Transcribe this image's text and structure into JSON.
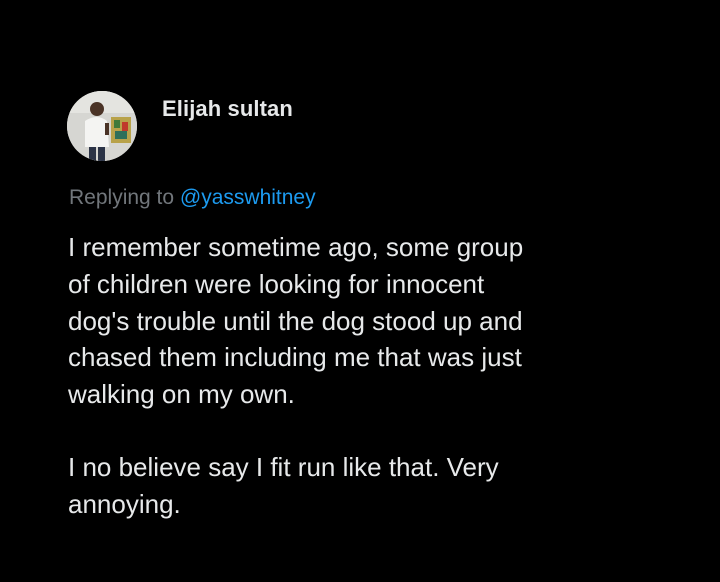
{
  "tweet": {
    "author": {
      "name": "Elijah sultan",
      "avatar_icon": "profile-photo"
    },
    "reply": {
      "prefix": "Replying to",
      "handle": "@yasswhitney"
    },
    "paragraphs": [
      "I remember sometime ago, some group\nof children were looking for innocent\ndog's trouble until the dog stood up and\nchased them including me that was just\nwalking on my own.",
      "I no believe say I fit run like that. Very\nannoying."
    ]
  },
  "colors": {
    "background": "#000000",
    "text": "#e7e9ea",
    "muted": "#71767b",
    "link": "#1d9bf0"
  }
}
